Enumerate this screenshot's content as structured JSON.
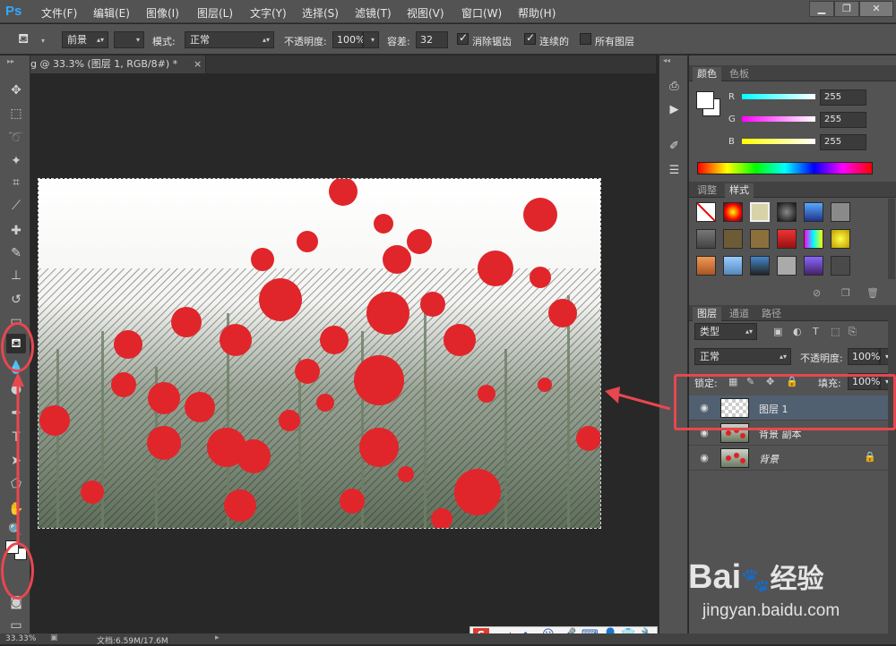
{
  "app": {
    "logo": "Ps",
    "menus": [
      "文件(F)",
      "编辑(E)",
      "图像(I)",
      "图层(L)",
      "文字(Y)",
      "选择(S)",
      "滤镜(T)",
      "视图(V)",
      "窗口(W)",
      "帮助(H)"
    ],
    "window_controls": [
      "minimize-icon",
      "restore-icon",
      "close-icon"
    ]
  },
  "options_bar": {
    "fill_source": "前景",
    "mode_label": "模式:",
    "mode_value": "正常",
    "opacity_label": "不透明度:",
    "opacity_value": "100%",
    "tolerance_label": "容差:",
    "tolerance_value": "32",
    "antialias_label": "消除锯齿",
    "contiguous_label": "连续的",
    "all_layers_label": "所有图层"
  },
  "document": {
    "tab_title": "g @ 33.3% (图层 1, RGB/8#) *"
  },
  "status": {
    "zoom": "33.33%",
    "doc_info": "文档:6.59M/17.6M"
  },
  "color_panel": {
    "tabs": [
      "颜色",
      "色板"
    ],
    "channels": [
      {
        "name": "R",
        "value": "255"
      },
      {
        "name": "G",
        "value": "255"
      },
      {
        "name": "B",
        "value": "255"
      }
    ]
  },
  "styles_panel": {
    "tabs": [
      "调整",
      "样式"
    ]
  },
  "layers_panel": {
    "tabs": [
      "图层",
      "通道",
      "路径"
    ],
    "filter_kind": "类型",
    "blend_mode": "正常",
    "opacity_label": "不透明度:",
    "opacity_value": "100%",
    "lock_label": "锁定:",
    "fill_label": "填充:",
    "fill_value": "100%",
    "layers": [
      {
        "name": "图层 1",
        "selected": true
      },
      {
        "name": "背景 副本",
        "selected": false
      },
      {
        "name": "背景",
        "selected": false,
        "locked": true
      }
    ]
  },
  "watermark": {
    "brand": "Bai",
    "brand_suffix": "经验",
    "url": "jingyan.baidu.com"
  },
  "ime_bar": {
    "label": "中"
  },
  "colors": {
    "annotation_red": "#e8474f",
    "selected_layer": "#506070",
    "panel_bg": "#535353"
  }
}
